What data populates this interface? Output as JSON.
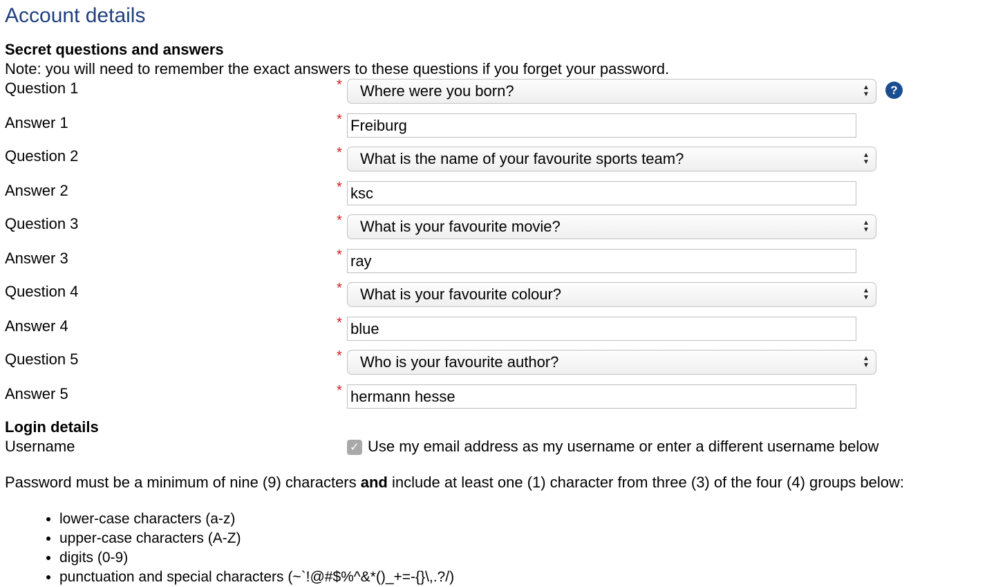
{
  "page_title": "Account details",
  "secret": {
    "heading": "Secret questions and answers",
    "note": "Note: you will need to remember the exact answers to these questions if you forget your password.",
    "required_mark": "*",
    "help_icon": "?",
    "pairs": [
      {
        "question_label": "Question 1",
        "question": "Where were you born?",
        "answer_label": "Answer 1",
        "answer": "Freiburg"
      },
      {
        "question_label": "Question 2",
        "question": "What is the name of your favourite sports team?",
        "answer_label": "Answer 2",
        "answer": "ksc"
      },
      {
        "question_label": "Question 3",
        "question": "What is your favourite movie?",
        "answer_label": "Answer 3",
        "answer": "ray"
      },
      {
        "question_label": "Question 4",
        "question": "What is your favourite colour?",
        "answer_label": "Answer 4",
        "answer": "blue"
      },
      {
        "question_label": "Question 5",
        "question": "Who is your favourite author?",
        "answer_label": "Answer 5",
        "answer": "hermann hesse"
      }
    ]
  },
  "login": {
    "heading": "Login details",
    "username_label": "Username",
    "use_email_checked": true,
    "use_email_label": "Use my email address as my username or enter a different username below"
  },
  "password": {
    "intro_before": "Password must be a minimum of nine (9) characters ",
    "intro_bold": "and",
    "intro_after": " include at least one (1) character from three (3) of the four (4) groups below:",
    "rules": [
      "lower-case characters (a-z)",
      "upper-case characters (A-Z)",
      "digits (0-9)",
      "punctuation and special characters (~`!@#$%^&*()_+=-{}\\,.?/)"
    ]
  },
  "colors": {
    "title": "#1f3f7d",
    "required": "#d11c1c",
    "help_icon_bg": "#1a4d8f"
  }
}
